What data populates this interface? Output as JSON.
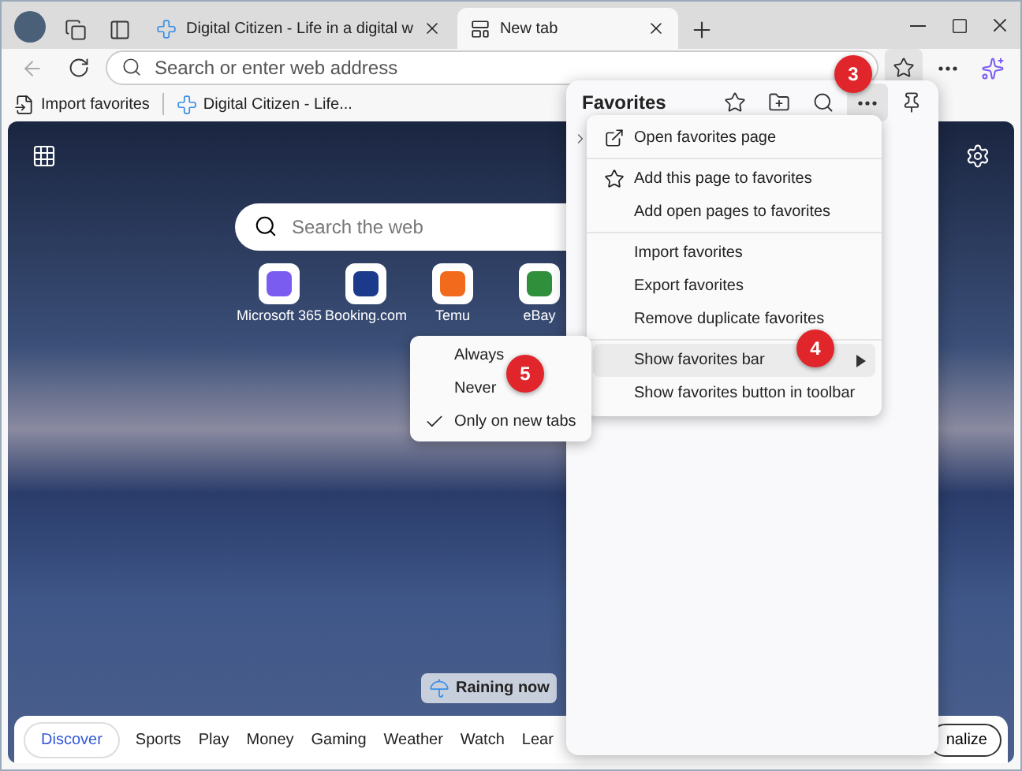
{
  "tabs": [
    {
      "title": "Digital Citizen - Life in a digital w",
      "selected": false,
      "kind": "site"
    },
    {
      "title": "New tab",
      "selected": true,
      "kind": "newtab"
    }
  ],
  "address_bar": {
    "placeholder": "Search or enter web address"
  },
  "favorites_bar": [
    {
      "label": "Import favorites",
      "kind": "import"
    },
    {
      "label": "Digital Citizen - Life...",
      "kind": "site"
    }
  ],
  "new_tab_page": {
    "search": {
      "placeholder": "Search the web"
    },
    "tiles": [
      {
        "label": "Microsoft 365",
        "color": "#7b5cf0"
      },
      {
        "label": "Booking.com",
        "color": "#1b3a8c"
      },
      {
        "label": "Temu",
        "color": "#f26b1d"
      },
      {
        "label": "eBay",
        "color": "#2f8f3a"
      }
    ],
    "weather": "Raining now",
    "nav": [
      {
        "label": "Discover",
        "selected": true
      },
      {
        "label": "Sports",
        "selected": false
      },
      {
        "label": "Play",
        "selected": false
      },
      {
        "label": "Money",
        "selected": false
      },
      {
        "label": "Gaming",
        "selected": false
      },
      {
        "label": "Weather",
        "selected": false
      },
      {
        "label": "Watch",
        "selected": false
      },
      {
        "label": "Lear",
        "selected": false
      }
    ],
    "personalize": "nalize"
  },
  "favorites_panel": {
    "title": "Favorites",
    "menu": [
      [
        {
          "label": "Open favorites page",
          "kind": "open",
          "selected": false
        }
      ],
      [
        {
          "label": "Add this page to favorites",
          "kind": "add",
          "selected": false
        },
        {
          "label": "Add open pages to favorites",
          "kind": "plain",
          "selected": false
        }
      ],
      [
        {
          "label": "Import favorites",
          "kind": "plain",
          "selected": false
        },
        {
          "label": "Export favorites",
          "kind": "plain",
          "selected": false
        },
        {
          "label": "Remove duplicate favorites",
          "kind": "plain",
          "selected": false
        }
      ],
      [
        {
          "label": "Show favorites bar",
          "kind": "submenu",
          "selected": true
        },
        {
          "label": "Show favorites button in toolbar",
          "kind": "plain",
          "selected": false
        }
      ]
    ],
    "submenu": [
      {
        "label": "Always",
        "checked": false
      },
      {
        "label": "Never",
        "checked": false
      },
      {
        "label": "Only on new tabs",
        "checked": true
      }
    ]
  },
  "markers": [
    "3",
    "4",
    "5"
  ]
}
